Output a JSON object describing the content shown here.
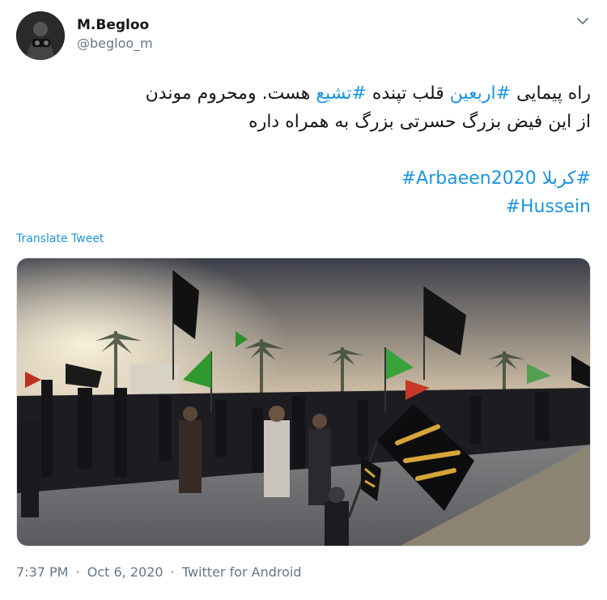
{
  "user": {
    "display_name": "M.Begloo",
    "handle": "@begloo_m"
  },
  "tweet": {
    "line1_pre": "راه پیمایی ",
    "tag_arbaeen_fa": "#اربعین",
    "line1_mid": " قلب تپنده ",
    "tag_tashyi": "#تشیع",
    "line1_post": " هست. ومحروم موندن",
    "line2": "از این فیض بزرگ حسرتی بزرگ به همراه داره",
    "tag_karbala": "#کربلا",
    "tag_arbaeen2020": "#Arbaeen2020",
    "tag_hussein": "#Hussein"
  },
  "translate_label": "Translate Tweet",
  "footer": {
    "time": "7:37 PM",
    "sep": "·",
    "date": "Oct 6, 2020",
    "source": "Twitter for Android"
  },
  "icons": {
    "avatar": "avatar-photo",
    "caret": "chevron-down-icon"
  },
  "colors": {
    "link": "#1b95e0",
    "secondary_text": "#657786",
    "primary_text": "#14171a"
  }
}
